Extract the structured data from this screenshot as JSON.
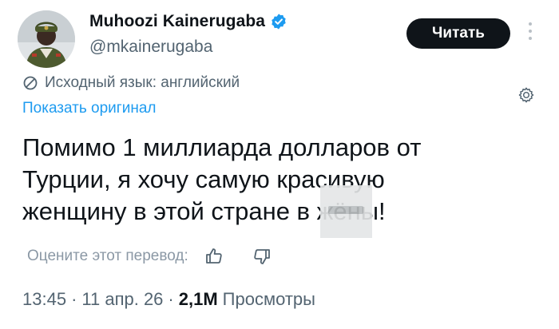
{
  "author": {
    "display_name": "Muhoozi Kainerugaba",
    "handle": "@mkainerugaba",
    "verified": true,
    "avatar_icon": "profile-photo"
  },
  "actions": {
    "follow_label": "Читать",
    "more_icon": "more-vertical-icon"
  },
  "translation": {
    "source_language": "Исходный язык: английский",
    "show_original": "Показать оригинал",
    "rate_label": "Оцените этот перевод:"
  },
  "tweet": {
    "text": "Помимо 1 миллиарда долларов от Турции, я хочу самую красивую женщину в этой стране в жёны!"
  },
  "meta": {
    "time": "13:45",
    "separator": "·",
    "date": "11 апр. 26",
    "views_count": "2,1M",
    "views_label": "Просмотры"
  },
  "colors": {
    "accent": "#1d9bf0",
    "text": "#0f1419",
    "secondary": "#536471",
    "button_bg": "#0f1419"
  }
}
